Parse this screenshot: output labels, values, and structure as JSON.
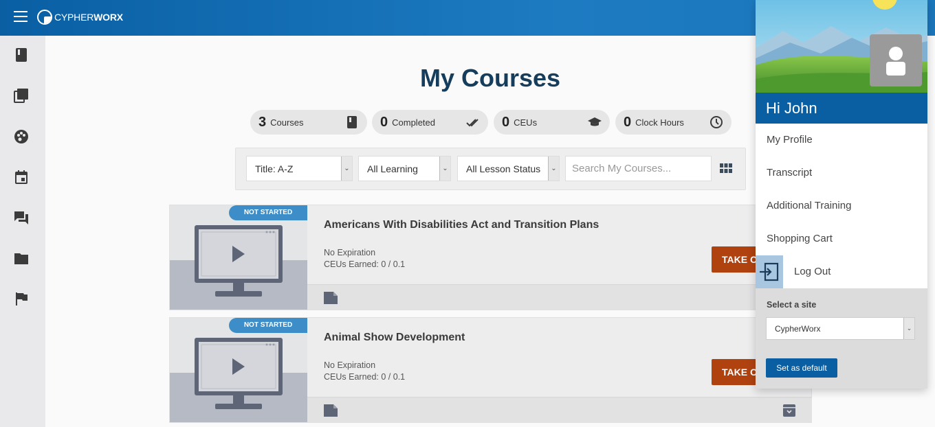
{
  "brand": {
    "logo_text_light": "CYPHER",
    "logo_text_bold": "WORX"
  },
  "sidebar": {
    "items": [
      {
        "icon": "book-icon"
      },
      {
        "icon": "library-icon"
      },
      {
        "icon": "palette-icon"
      },
      {
        "icon": "calendar-icon"
      },
      {
        "icon": "chat-icon"
      },
      {
        "icon": "folder-icon"
      },
      {
        "icon": "flag-icon"
      }
    ]
  },
  "page": {
    "title": "My Courses"
  },
  "stats": [
    {
      "value": "3",
      "label": "Courses",
      "icon": "book-icon"
    },
    {
      "value": "0",
      "label": "Completed",
      "icon": "double-check-icon"
    },
    {
      "value": "0",
      "label": "CEUs",
      "icon": "graduation-cap-icon"
    },
    {
      "value": "0",
      "label": "Clock Hours",
      "icon": "clock-icon"
    }
  ],
  "filters": {
    "sort": "Title: A-Z",
    "learning": "All Learning",
    "lesson_status": "All Lesson Status",
    "search_placeholder": "Search My Courses..."
  },
  "courses": [
    {
      "status": "NOT STARTED",
      "title": "Americans With Disabilities Act and Transition Plans",
      "expiration": "No Expiration",
      "ceus": "CEUs Earned: 0 / 0.1",
      "action": "TAKE CO"
    },
    {
      "status": "NOT STARTED",
      "title": "Animal Show Development",
      "expiration": "No Expiration",
      "ceus": "CEUs Earned: 0 / 0.1",
      "action": "TAKE CO"
    }
  ],
  "user_menu": {
    "greeting": "Hi John",
    "items": [
      "My Profile",
      "Transcript",
      "Additional Training",
      "Shopping Cart",
      "Log Out"
    ],
    "site_label": "Select a site",
    "site_value": "CypherWorx",
    "default_button": "Set as default"
  },
  "colors": {
    "header": "#0a5fa3",
    "accent_button": "#b04210",
    "badge": "#3d8ec8",
    "title": "#163e5c"
  }
}
